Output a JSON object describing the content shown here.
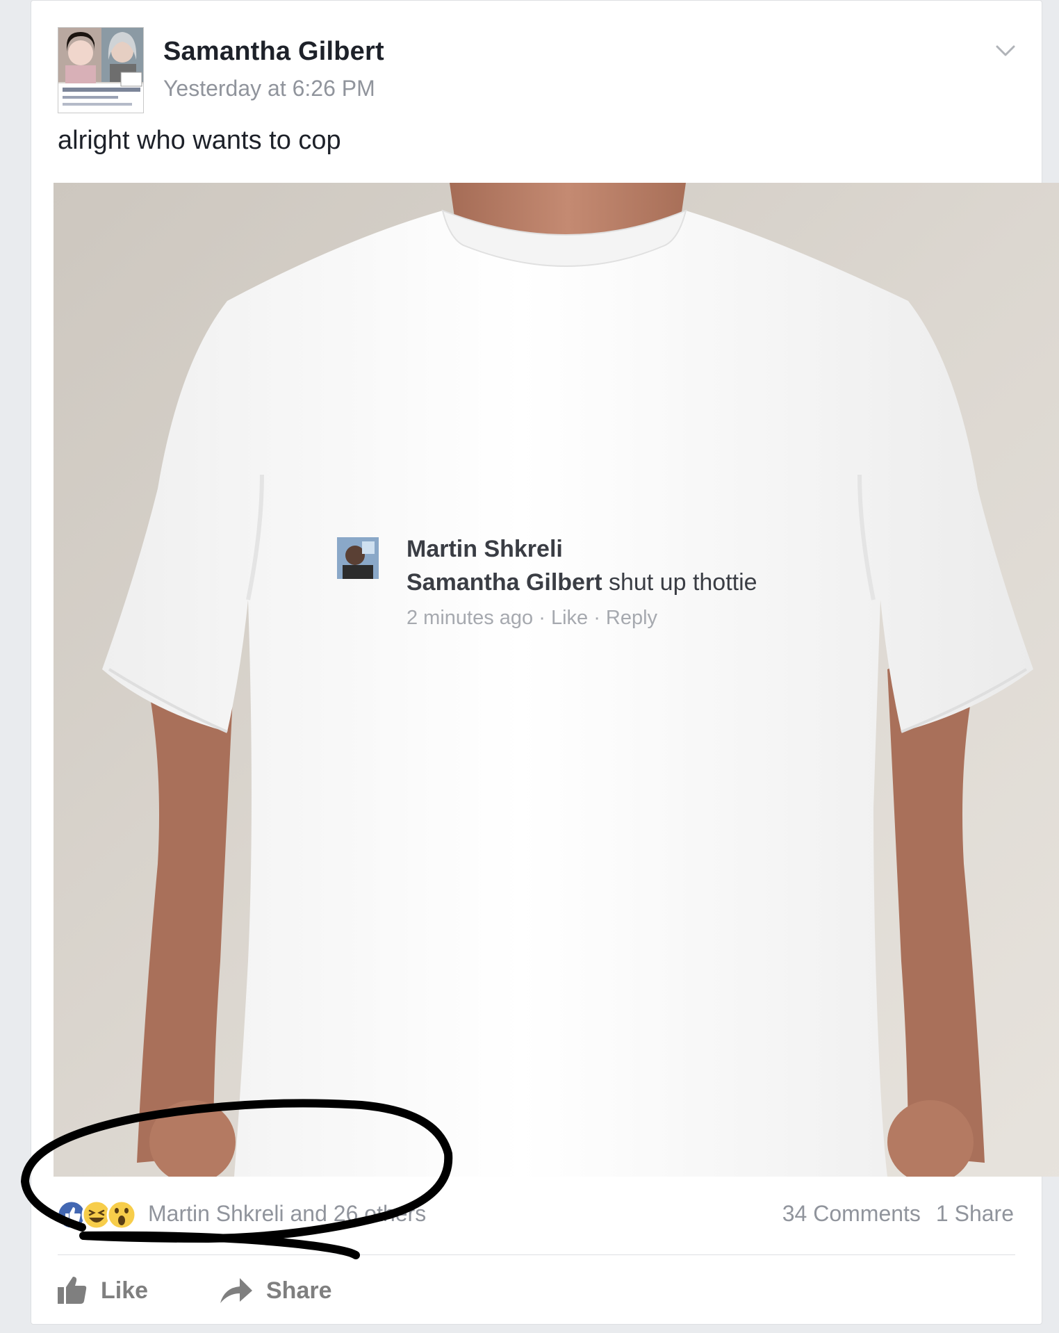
{
  "post": {
    "author": "Samantha Gilbert",
    "timestamp": "Yesterday at 6:26 PM",
    "text": "alright who wants to cop",
    "menu_icon": "chevron-down-icon"
  },
  "shirt_print": {
    "commenter": "Martin Shkreli",
    "mention": "Samantha Gilbert",
    "comment": " shut up thottie",
    "meta": "2 minutes ago · Like · Reply"
  },
  "stats": {
    "reaction_icons": [
      "like-reaction-icon",
      "haha-reaction-icon",
      "wow-reaction-icon"
    ],
    "reactors": "Martin Shkreli and 26 others",
    "comments": "34 Comments",
    "shares": "1 Share"
  },
  "actions": {
    "like_label": "Like",
    "share_label": "Share"
  },
  "colors": {
    "facebook_blue": "#4267b2",
    "text_dark": "#1d2129",
    "text_muted": "#90949c",
    "annotation_ink": "#000000"
  }
}
